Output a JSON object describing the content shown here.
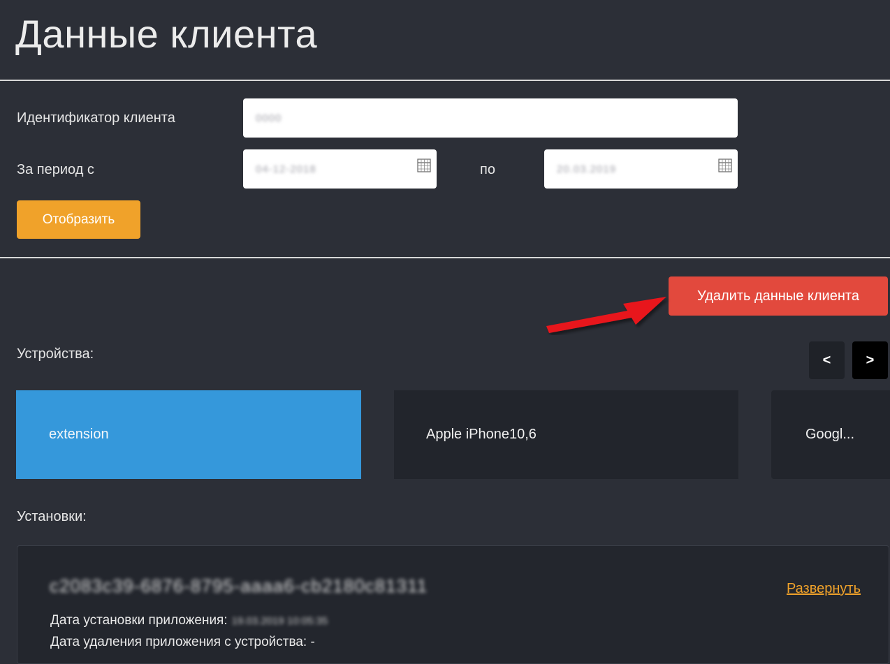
{
  "page": {
    "title": "Данные клиента"
  },
  "form": {
    "client_id_label": "Идентификатор клиента",
    "client_id_value": "0000",
    "period_from_label": "За период с",
    "period_from_value": "04-12-2018",
    "period_to_label": "по",
    "period_to_value": "20.03.2019",
    "show_button": "Отобразить"
  },
  "actions": {
    "delete_button": "Удалить данные клиента"
  },
  "devices": {
    "label": "Устройства:",
    "prev": "<",
    "next": ">",
    "items": [
      {
        "label": "extension",
        "selected": true
      },
      {
        "label": "Apple iPhone10,6",
        "selected": false
      },
      {
        "label": "Googl...",
        "selected": false
      }
    ]
  },
  "installs": {
    "label": "Установки:",
    "items": [
      {
        "id": "c2083c39-6876-8795-aaaa6-cb2180c81311",
        "expand_link": "Развернуть",
        "install_date_label": "Дата установки приложения:",
        "install_date_value": "19.03.2019 10:05:35",
        "uninstall_date_label": "Дата удаления приложения с устройства:",
        "uninstall_date_value": "-"
      }
    ]
  },
  "colors": {
    "background": "#2c2f37",
    "accent_orange": "#f0a22a",
    "danger_red": "#e2493d",
    "selected_blue": "#3598db",
    "card_dark": "#22252c",
    "arrow_red": "#e8161b"
  }
}
